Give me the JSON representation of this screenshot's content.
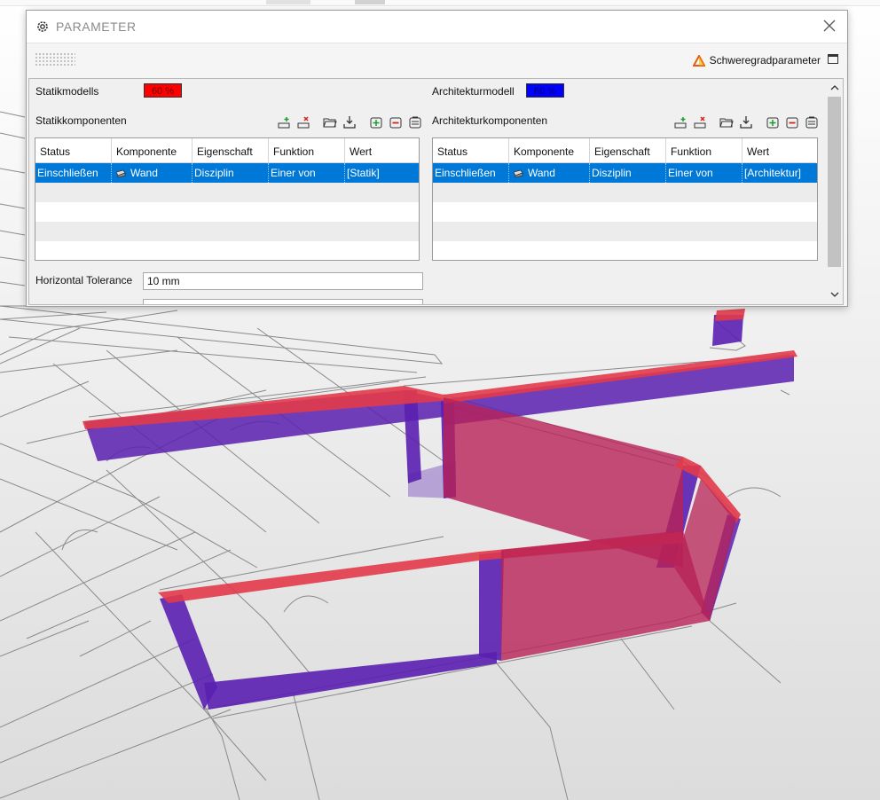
{
  "dialog": {
    "title": "PARAMETER",
    "severity_label": "Schweregradparameter"
  },
  "left": {
    "model_label": "Statikmodells",
    "model_percent": "60 %",
    "model_color": "#ff0000",
    "components_label": "Statikkomponenten",
    "columns": [
      "Status",
      "Komponente",
      "Eigenschaft",
      "Funktion",
      "Wert"
    ],
    "rows": [
      {
        "status": "Einschließen",
        "komponente": "Wand",
        "eigenschaft": "Disziplin",
        "funktion": "Einer von",
        "wert": "[Statik]"
      }
    ],
    "tolerance_label": "Horizontal Tolerance",
    "tolerance_value": "10 mm"
  },
  "right": {
    "model_label": "Architekturmodell",
    "model_percent": "60 %",
    "model_color": "#0000ff",
    "components_label": "Architekturkomponenten",
    "columns": [
      "Status",
      "Komponente",
      "Eigenschaft",
      "Funktion",
      "Wert"
    ],
    "rows": [
      {
        "status": "Einschließen",
        "komponente": "Wand",
        "eigenschaft": "Disziplin",
        "funktion": "Einer von",
        "wert": "[Architektur]"
      }
    ]
  },
  "icons": {
    "settings": "gear-icon",
    "close": "close-icon",
    "severity": "warning-triangle-icon",
    "window": "window-icon",
    "toolbar": [
      "add-row-icon",
      "remove-row-icon",
      "open-folder-icon",
      "download-icon",
      "add-group-icon",
      "remove-group-icon",
      "clear-group-icon"
    ]
  },
  "colors": {
    "selection": "#0078d7",
    "structural_wall": "#e23a4a",
    "architectural_wall": "#5a1fb0"
  }
}
